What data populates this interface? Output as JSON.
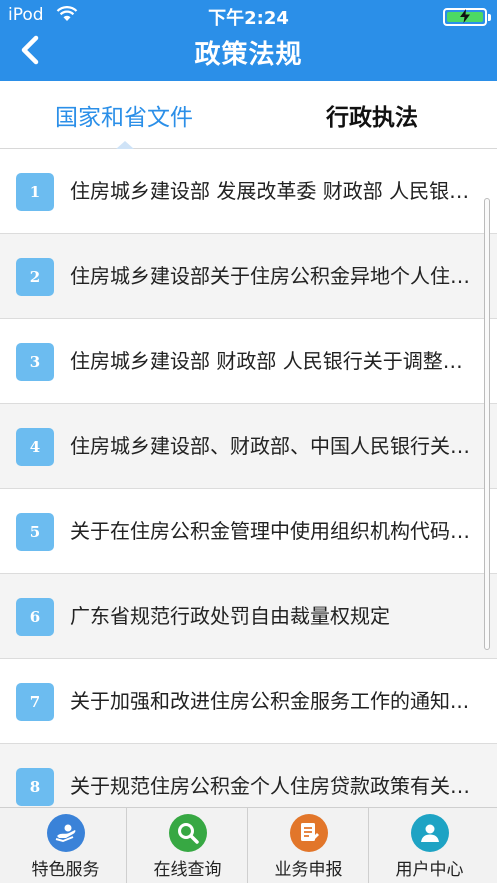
{
  "status": {
    "carrier": "iPod",
    "time": "下午2:24"
  },
  "nav": {
    "title": "政策法规"
  },
  "tabs": [
    {
      "label": "国家和省文件",
      "active": true
    },
    {
      "label": "行政执法",
      "active": false
    }
  ],
  "list": [
    {
      "num": "1",
      "title": "住房城乡建设部 发展改革委 财政部 人民银行关于..."
    },
    {
      "num": "2",
      "title": "住房城乡建设部关于住房公积金异地个人住房贷款..."
    },
    {
      "num": "3",
      "title": "住房城乡建设部 财政部 人民银行关于调整住房公..."
    },
    {
      "num": "4",
      "title": "住房城乡建设部、财政部、中国人民银行关于..."
    },
    {
      "num": "5",
      "title": "关于在住房公积金管理中使用组织机构代码的..."
    },
    {
      "num": "6",
      "title": "广东省规范行政处罚自由裁量权规定"
    },
    {
      "num": "7",
      "title": "关于加强和改进住房公积金服务工作的通知..."
    },
    {
      "num": "8",
      "title": "关于规范住房公积金个人住房贷款政策有关问题..."
    }
  ],
  "bottom_tabs": [
    {
      "label": "特色服务",
      "icon": "service-icon",
      "color": "#3a82d8"
    },
    {
      "label": "在线查询",
      "icon": "search-icon",
      "color": "#37a843"
    },
    {
      "label": "业务申报",
      "icon": "document-icon",
      "color": "#e2762a"
    },
    {
      "label": "用户中心",
      "icon": "user-icon",
      "color": "#1ea3c4"
    }
  ],
  "colors": {
    "accent": "#2b8fe8",
    "badge": "#6cbcf0",
    "battery": "#4cd964"
  }
}
